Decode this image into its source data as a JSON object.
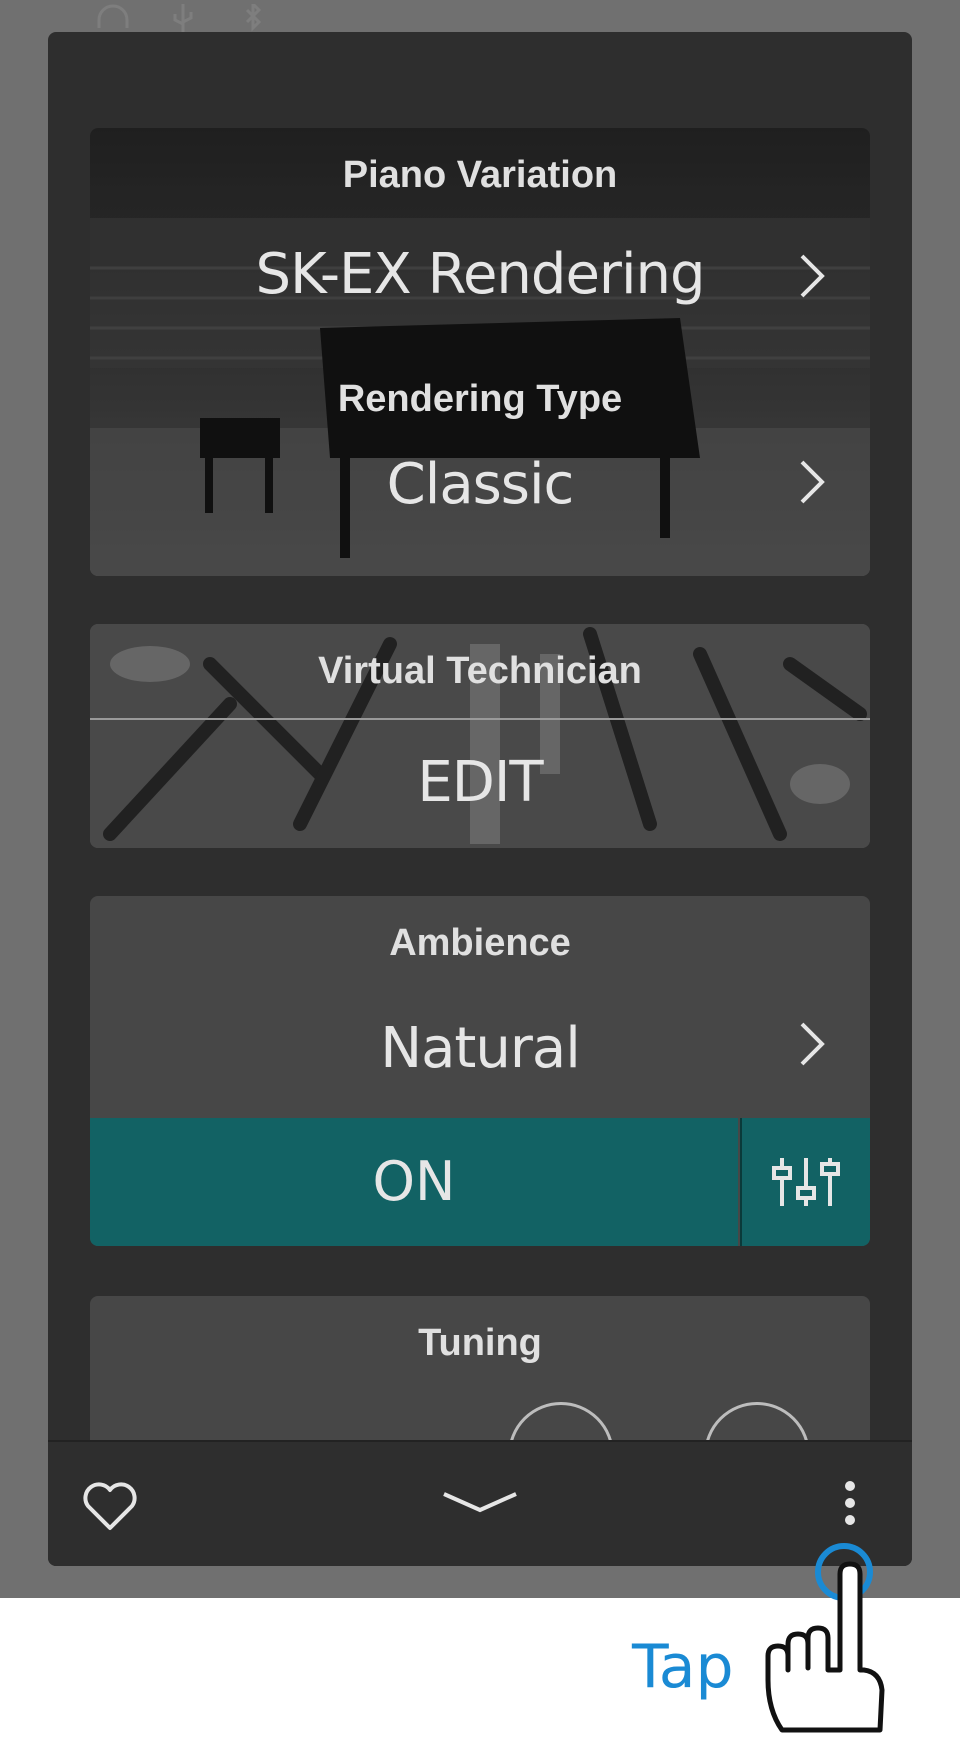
{
  "piano_variation": {
    "label": "Piano Variation",
    "value": "SK-EX Rendering"
  },
  "rendering_type": {
    "label": "Rendering Type",
    "value": "Classic"
  },
  "virtual_technician": {
    "label": "Virtual Technician",
    "action": "EDIT"
  },
  "ambience": {
    "label": "Ambience",
    "value": "Natural",
    "toggle": "ON"
  },
  "tuning": {
    "label": "Tuning"
  },
  "bottom_bar": {
    "favorite_icon": "heart-icon",
    "collapse_icon": "chevron-down-icon",
    "more_icon": "more-vertical-icon"
  },
  "hint": {
    "tap_text": "Tap"
  },
  "colors": {
    "accent_teal": "#126264",
    "tap_blue": "#1a8ad4",
    "panel_bg": "#2e2e2e"
  }
}
